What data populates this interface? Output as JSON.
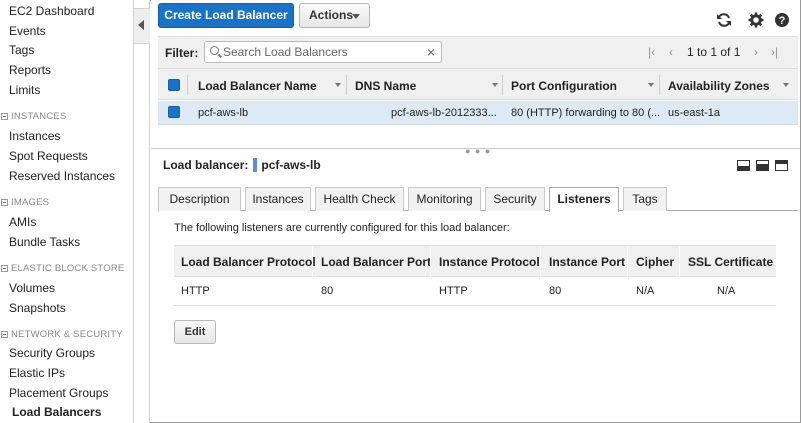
{
  "sidebar": {
    "items_top": [
      "EC2 Dashboard",
      "Events",
      "Tags",
      "Reports",
      "Limits"
    ],
    "sections": {
      "instances": {
        "title": "INSTANCES",
        "items": [
          "Instances",
          "Spot Requests",
          "Reserved Instances"
        ]
      },
      "images": {
        "title": "IMAGES",
        "items": [
          "AMIs",
          "Bundle Tasks"
        ]
      },
      "ebs": {
        "title": "ELASTIC BLOCK STORE",
        "items": [
          "Volumes",
          "Snapshots"
        ]
      },
      "network": {
        "title": "NETWORK & SECURITY",
        "items": [
          "Security Groups",
          "Elastic IPs",
          "Placement Groups",
          "Load Balancers"
        ]
      }
    },
    "active_item": "Load Balancers"
  },
  "toolbar": {
    "create_label": "Create Load Balancer",
    "actions_label": "Actions",
    "icons": [
      "refresh-icon",
      "gear-icon",
      "help-icon"
    ]
  },
  "filter": {
    "label": "Filter:",
    "placeholder": "Search Load Balancers",
    "pagination_text": "1 to 1 of 1"
  },
  "grid": {
    "columns": [
      "Load Balancer Name",
      "DNS Name",
      "Port Configuration",
      "Availability Zones"
    ],
    "rows": [
      {
        "name": "pcf-aws-lb",
        "dns": "pcf-aws-lb-2012333...",
        "port": "80 (HTTP) forwarding to 80 (...",
        "az": "us-east-1a"
      }
    ]
  },
  "detail": {
    "label": "Load balancer:",
    "name": "pcf-aws-lb",
    "tabs": [
      "Description",
      "Instances",
      "Health Check",
      "Monitoring",
      "Security",
      "Listeners",
      "Tags"
    ],
    "active_tab": "Listeners",
    "intro": "The following listeners are currently configured for this load balancer:",
    "listener_columns": [
      "Load Balancer Protocol",
      "Load Balancer Port",
      "Instance Protocol",
      "Instance Port",
      "Cipher",
      "SSL Certificate"
    ],
    "listener_rows": [
      [
        "HTTP",
        "80",
        "HTTP",
        "80",
        "N/A",
        "N/A"
      ]
    ],
    "edit_label": "Edit"
  },
  "colors": {
    "primary": "#1a73c4",
    "selected_row": "#dde9f5",
    "header_bg": "#f0f0f0"
  }
}
